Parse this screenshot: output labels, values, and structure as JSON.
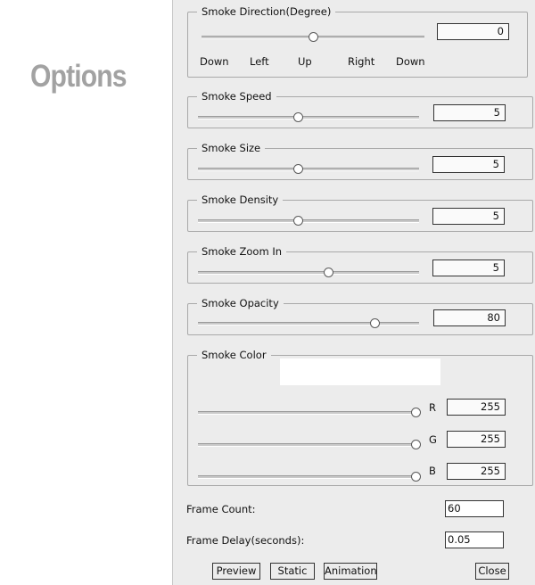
{
  "sidebar": {
    "title": "Options"
  },
  "direction": {
    "legend": "Smoke Direction(Degree)",
    "value": "0",
    "slider_fraction": 0.5,
    "ticks": [
      "Down",
      "Left",
      "Up",
      "Right",
      "Down"
    ]
  },
  "speed": {
    "legend": "Smoke Speed",
    "value": "5",
    "slider_fraction": 0.45
  },
  "size": {
    "legend": "Smoke Size",
    "value": "5",
    "slider_fraction": 0.45
  },
  "density": {
    "legend": "Smoke Density",
    "value": "5",
    "slider_fraction": 0.45
  },
  "zoom": {
    "legend": "Smoke Zoom In",
    "value": "5",
    "slider_fraction": 0.59
  },
  "opacity": {
    "legend": "Smoke Opacity",
    "value": "80",
    "slider_fraction": 0.8
  },
  "color": {
    "legend": "Smoke Color",
    "swatch": "#ffffff",
    "r": {
      "label": "R",
      "value": "255",
      "slider_fraction": 1.0
    },
    "g": {
      "label": "G",
      "value": "255",
      "slider_fraction": 1.0
    },
    "b": {
      "label": "B",
      "value": "255",
      "slider_fraction": 1.0
    }
  },
  "frame_count": {
    "label": "Frame Count:",
    "value": "60"
  },
  "frame_delay": {
    "label": "Frame Delay(seconds):",
    "value": "0.05"
  },
  "buttons": {
    "preview": "Preview",
    "static": "Static",
    "animation": "Animation",
    "close": "Close"
  }
}
